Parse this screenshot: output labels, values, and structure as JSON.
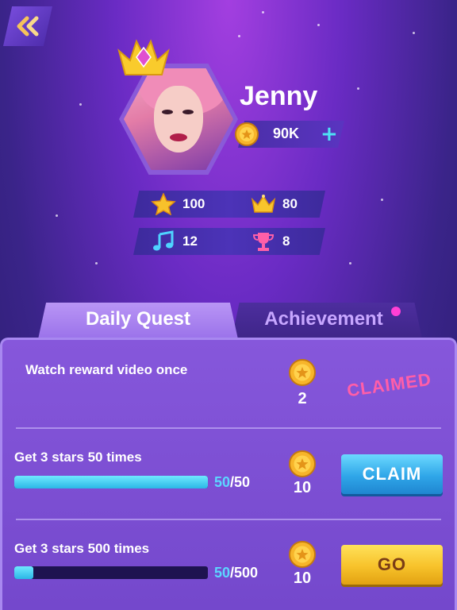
{
  "player": {
    "name": "Jenny",
    "coins": "90K"
  },
  "stats": {
    "stars": "100",
    "crowns": "80",
    "songs": "12",
    "trophies": "8"
  },
  "tabs": {
    "daily_quest": "Daily Quest",
    "achievement": "Achievement"
  },
  "quests": [
    {
      "title": "Watch reward video once",
      "reward": "2",
      "status_label": "CLAIMED"
    },
    {
      "title": "Get 3 stars 50 times",
      "progress_current": "50",
      "progress_total": "/50",
      "progress_fraction": 1.0,
      "reward": "10",
      "button_label": "CLAIM"
    },
    {
      "title": "Get 3 stars 500 times",
      "progress_current": "50",
      "progress_total": "/500",
      "progress_fraction": 0.1,
      "reward": "10",
      "button_label": "GO"
    }
  ],
  "colors": {
    "claim_button": "#2fa6e8",
    "go_button": "#f7c22a",
    "progress_fill": "#2bb7e6",
    "claimed_text": "#ff5ea8",
    "notification_dot": "#ff3fd5"
  },
  "icons": {
    "back": "double-chevron-left-icon",
    "coin": "coin-icon",
    "plus": "plus-icon",
    "star": "star-icon",
    "crown": "crown-icon",
    "music": "music-note-icon",
    "trophy": "trophy-icon"
  }
}
